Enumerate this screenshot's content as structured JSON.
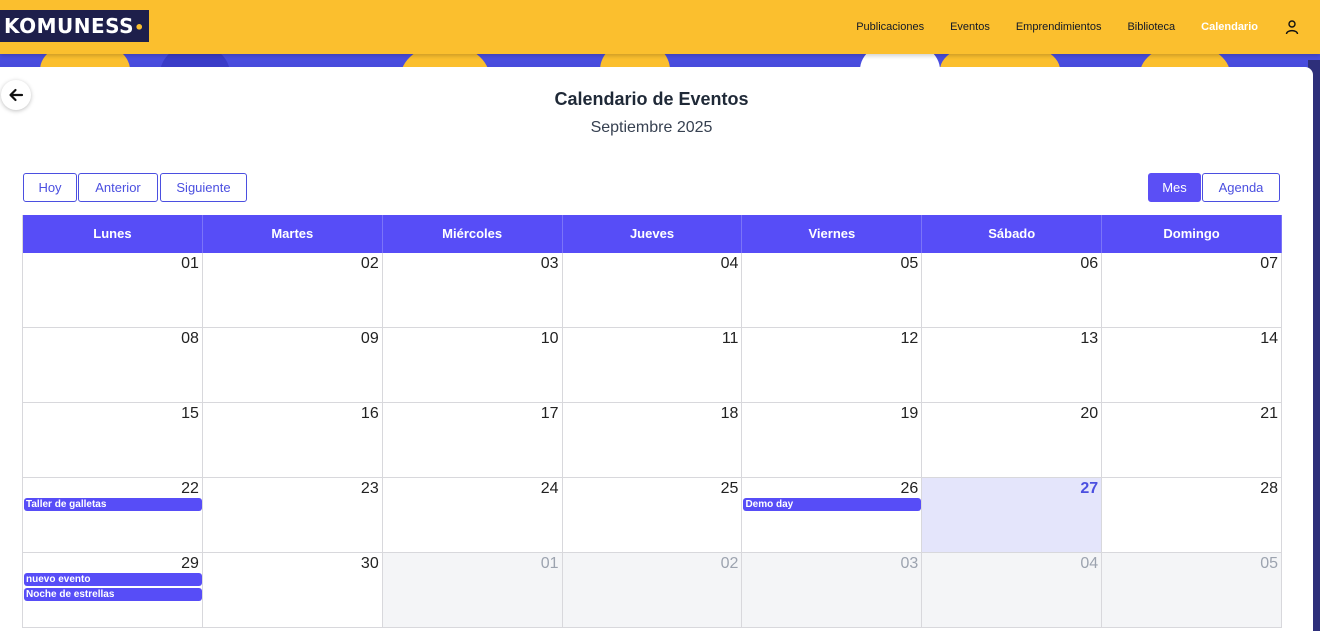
{
  "header": {
    "logo_text": "KOMUNESS",
    "nav": [
      "Publicaciones",
      "Eventos",
      "Emprendimientos",
      "Biblioteca",
      "Calendario"
    ],
    "active_nav": "Calendario",
    "user_icon": "user-icon"
  },
  "page": {
    "title": "Calendario de Eventos",
    "subtitle": "Septiembre 2025"
  },
  "toolbar": {
    "today": "Hoy",
    "prev": "Anterior",
    "next": "Siguiente",
    "month": "Mes",
    "agenda": "Agenda",
    "active_view": "Mes"
  },
  "colors": {
    "brand_yellow": "#fbbf2e",
    "accent": "#574df7",
    "today_bg": "#e4e5fb"
  },
  "calendar": {
    "weekdays": [
      "Lunes",
      "Martes",
      "Miércoles",
      "Jueves",
      "Viernes",
      "Sábado",
      "Domingo"
    ],
    "weeks": [
      [
        {
          "n": "01"
        },
        {
          "n": "02"
        },
        {
          "n": "03"
        },
        {
          "n": "04"
        },
        {
          "n": "05"
        },
        {
          "n": "06"
        },
        {
          "n": "07"
        }
      ],
      [
        {
          "n": "08"
        },
        {
          "n": "09"
        },
        {
          "n": "10"
        },
        {
          "n": "11"
        },
        {
          "n": "12"
        },
        {
          "n": "13"
        },
        {
          "n": "14"
        }
      ],
      [
        {
          "n": "15"
        },
        {
          "n": "16"
        },
        {
          "n": "17"
        },
        {
          "n": "18"
        },
        {
          "n": "19"
        },
        {
          "n": "20"
        },
        {
          "n": "21"
        }
      ],
      [
        {
          "n": "22",
          "events": [
            "Taller de galletas"
          ]
        },
        {
          "n": "23"
        },
        {
          "n": "24"
        },
        {
          "n": "25"
        },
        {
          "n": "26",
          "events": [
            "Demo day"
          ]
        },
        {
          "n": "27",
          "today": true
        },
        {
          "n": "28"
        }
      ],
      [
        {
          "n": "29",
          "events": [
            "nuevo evento",
            "Noche de estrellas"
          ]
        },
        {
          "n": "30"
        },
        {
          "n": "01",
          "other": true
        },
        {
          "n": "02",
          "other": true
        },
        {
          "n": "03",
          "other": true
        },
        {
          "n": "04",
          "other": true
        },
        {
          "n": "05",
          "other": true
        }
      ]
    ]
  }
}
